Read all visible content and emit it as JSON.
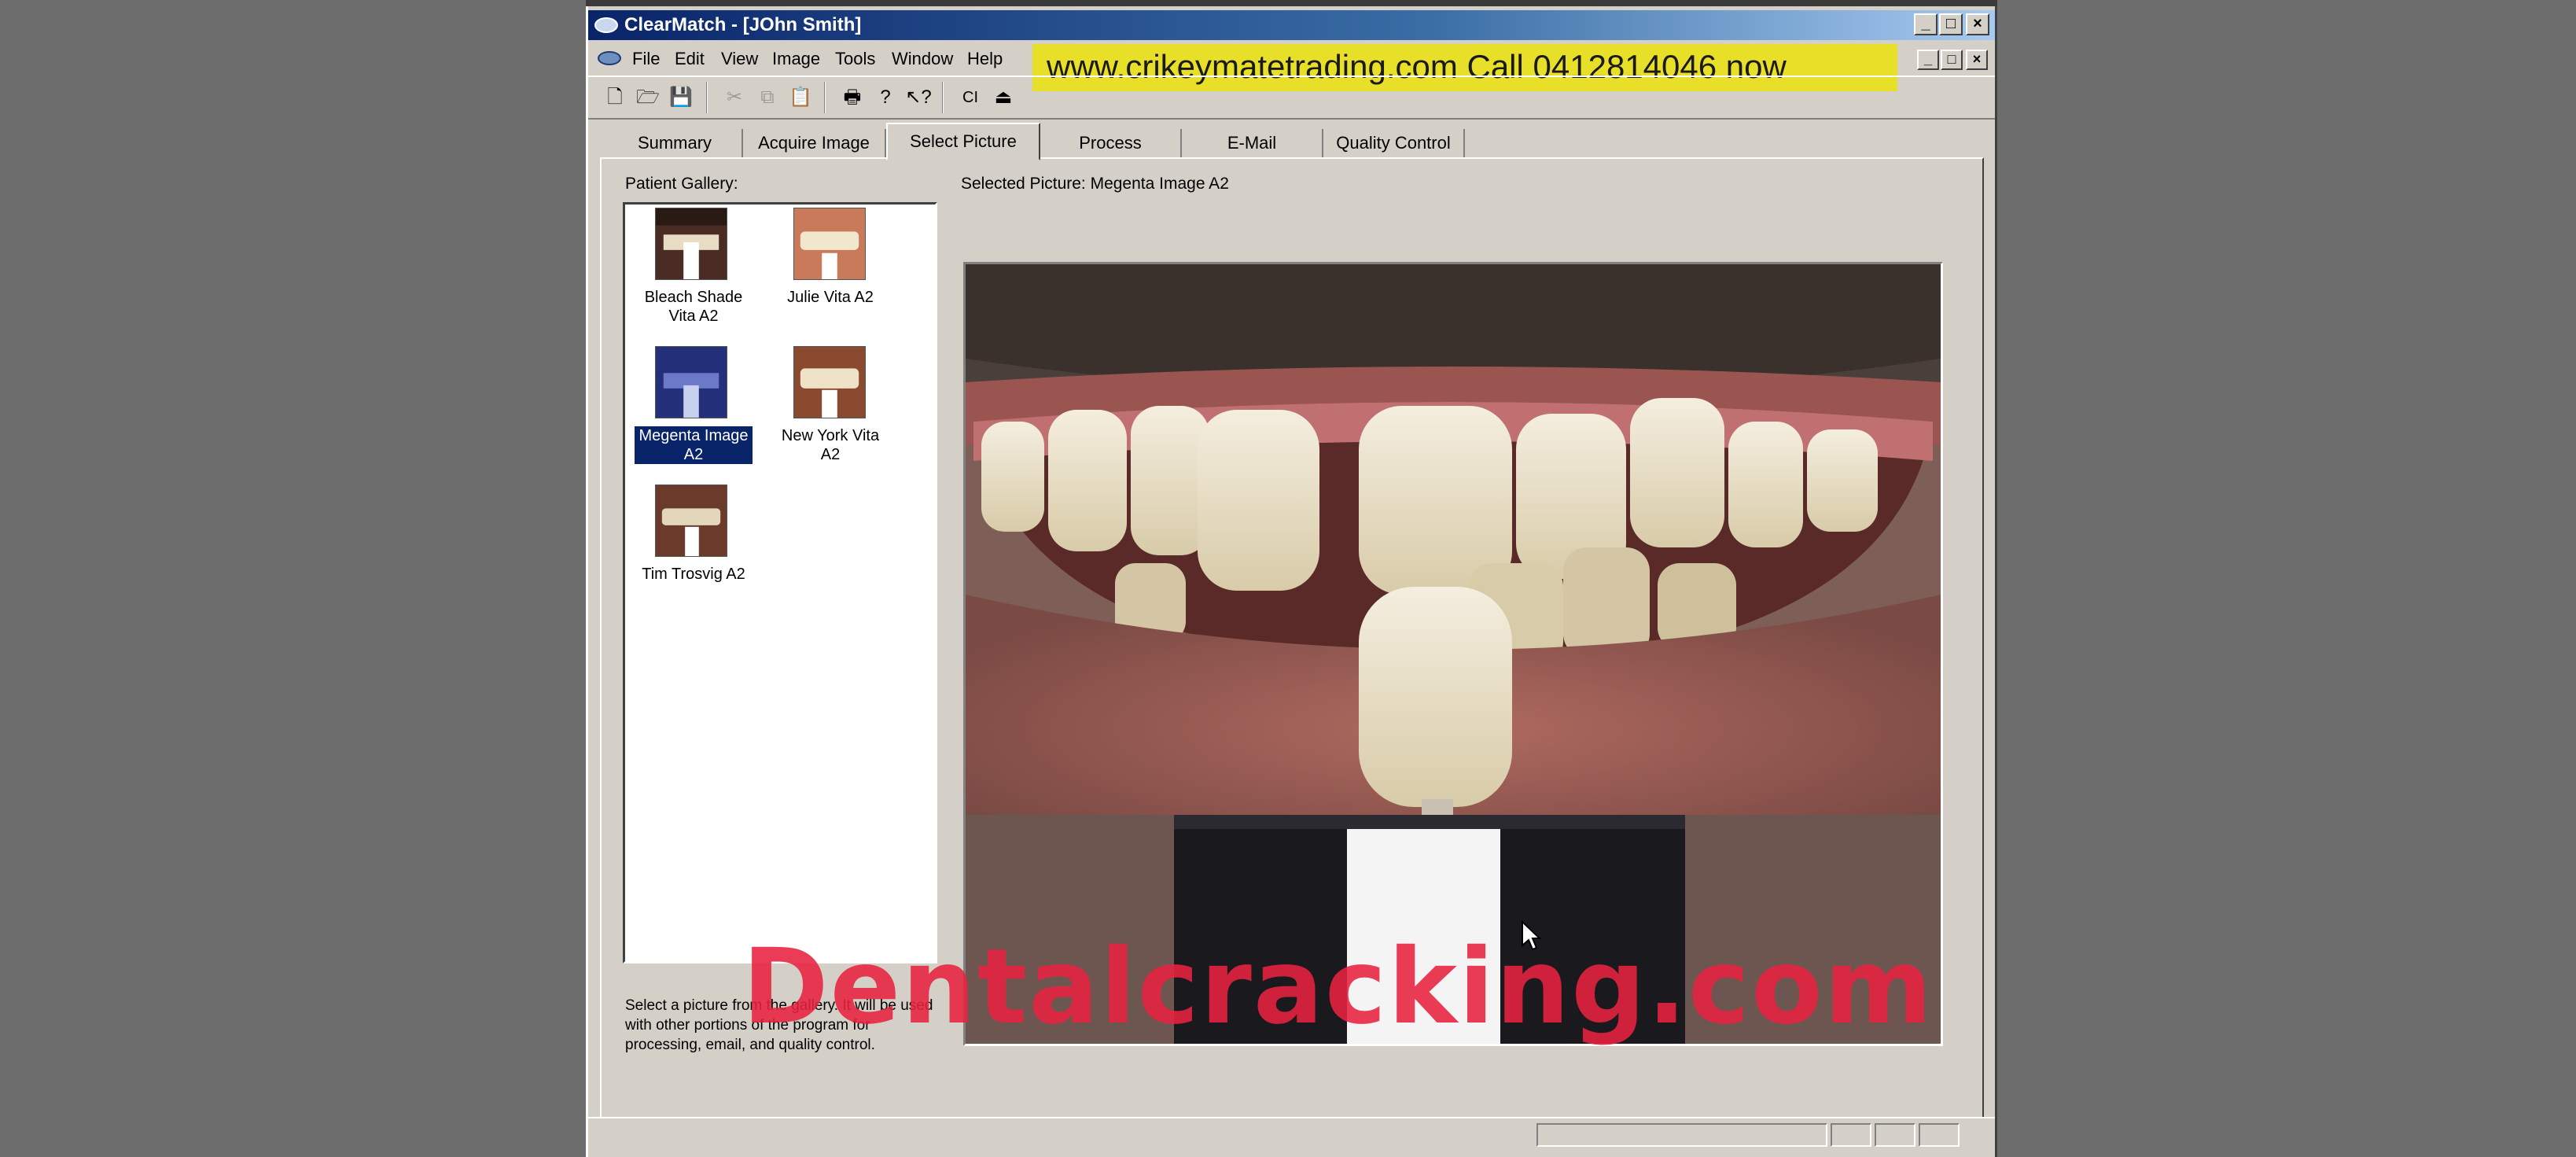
{
  "window": {
    "title": "ClearMatch - [JOhn Smith]",
    "minimize_glyph": "_",
    "maximize_glyph": "□",
    "close_glyph": "×"
  },
  "menu": [
    "File",
    "Edit",
    "View",
    "Image",
    "Tools",
    "Window",
    "Help"
  ],
  "banner": {
    "text": "www.crikeymatetrading.com Call 0412814046 now"
  },
  "toolbar": {
    "buttons": [
      {
        "icon": "new-file-icon",
        "glyph": "🗋"
      },
      {
        "icon": "open-folder-icon",
        "glyph": "🗁"
      },
      {
        "icon": "save-icon",
        "glyph": "💾"
      },
      {
        "icon": "cut-icon",
        "glyph": "✂"
      },
      {
        "icon": "copy-icon",
        "glyph": "⧉"
      },
      {
        "icon": "paste-icon",
        "glyph": "📋"
      },
      {
        "icon": "print-icon",
        "glyph": "🖶"
      },
      {
        "icon": "help-icon",
        "glyph": "?"
      },
      {
        "icon": "context-help-icon",
        "glyph": "↖?"
      },
      {
        "icon": "ci-icon",
        "glyph": "CI"
      },
      {
        "icon": "eject-icon",
        "glyph": "⏏"
      }
    ]
  },
  "tabs": [
    {
      "label": "Summary"
    },
    {
      "label": "Acquire Image"
    },
    {
      "label": "Select Picture",
      "active": true
    },
    {
      "label": "Process"
    },
    {
      "label": "E-Mail"
    },
    {
      "label": "Quality Control"
    }
  ],
  "gallery": {
    "label": "Patient Gallery:",
    "items": [
      {
        "caption": "Bleach Shade Vita A2",
        "selected": false
      },
      {
        "caption": "Julie Vita A2",
        "selected": false
      },
      {
        "caption": "Megenta Image A2",
        "selected": true
      },
      {
        "caption": "New York Vita A2",
        "selected": false
      },
      {
        "caption": "Tim Trosvig A2",
        "selected": false
      }
    ]
  },
  "selected_picture": {
    "label": "Selected Picture: Megenta Image A2"
  },
  "help_text": "Select a picture from the gallery. It will be used with other portions of the program for processing, email, and quality control.",
  "watermark": "Dentalcracking.com",
  "colors": {
    "titlebar_start": "#0a246a",
    "selection": "#0a246a",
    "banner_bg": "#e8df28",
    "watermark": "#e8223f",
    "face": "#d4d0c8"
  }
}
